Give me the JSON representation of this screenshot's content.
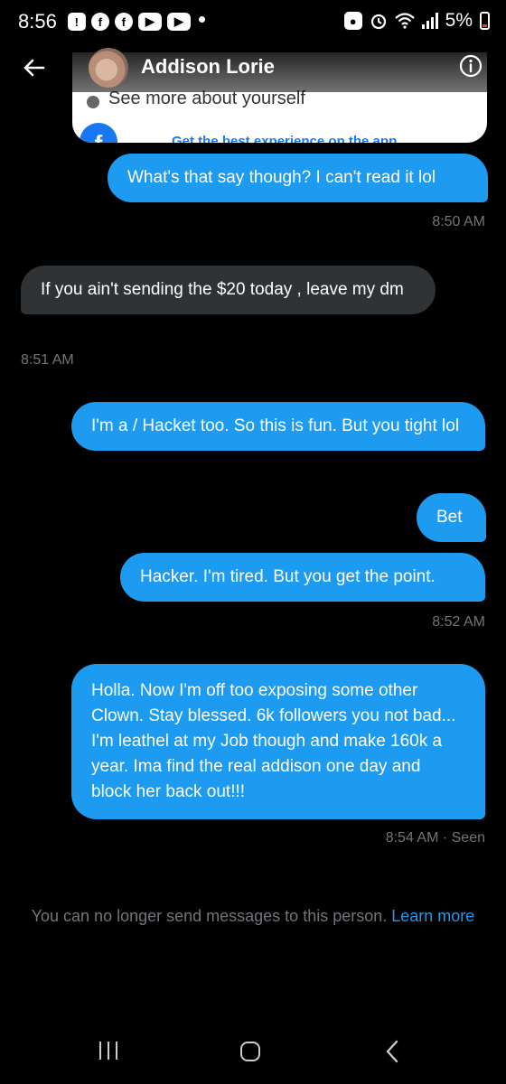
{
  "status_bar": {
    "time": "8:56",
    "notification_icons": [
      "alert-icon",
      "facebook-icon",
      "facebook-icon",
      "youtube-icon",
      "youtube-icon"
    ],
    "battery_percent": "5%"
  },
  "shared_card": {
    "line1": "See more about yourself",
    "line2": "Get the best experience on the app"
  },
  "header": {
    "title": "Addison Lorie"
  },
  "messages": [
    {
      "text": "What's that say though? I can't read it lol",
      "direction": "out"
    },
    {
      "timestamp": "8:50 AM"
    },
    {
      "text": "If you ain't sending the $20 today , leave my dm",
      "direction": "in"
    },
    {
      "timestamp": "8:51 AM"
    },
    {
      "text": "I'm a / Hacket too. So this is fun.  But you tight lol",
      "direction": "out"
    },
    {
      "text": "Bet",
      "direction": "out"
    },
    {
      "text": "Hacker. I'm tired. But you get the point.",
      "direction": "out"
    },
    {
      "timestamp": "8:52 AM"
    },
    {
      "text": "Holla. Now I'm off too exposing some other Clown. Stay blessed. 6k followers you not bad... I'm leathel at my Job though and make 160k a year. Ima find the real addison one day and block her back out!!!",
      "direction": "out"
    },
    {
      "timestamp": "8:54 AM · Seen"
    }
  ],
  "footer": {
    "notice": "You can no longer send messages to this person.",
    "link": "Learn more"
  },
  "colors": {
    "outgoing_bubble": "#1d9bf0",
    "incoming_bubble": "#2f3336",
    "background": "#000000",
    "secondary_text": "#71767b"
  }
}
